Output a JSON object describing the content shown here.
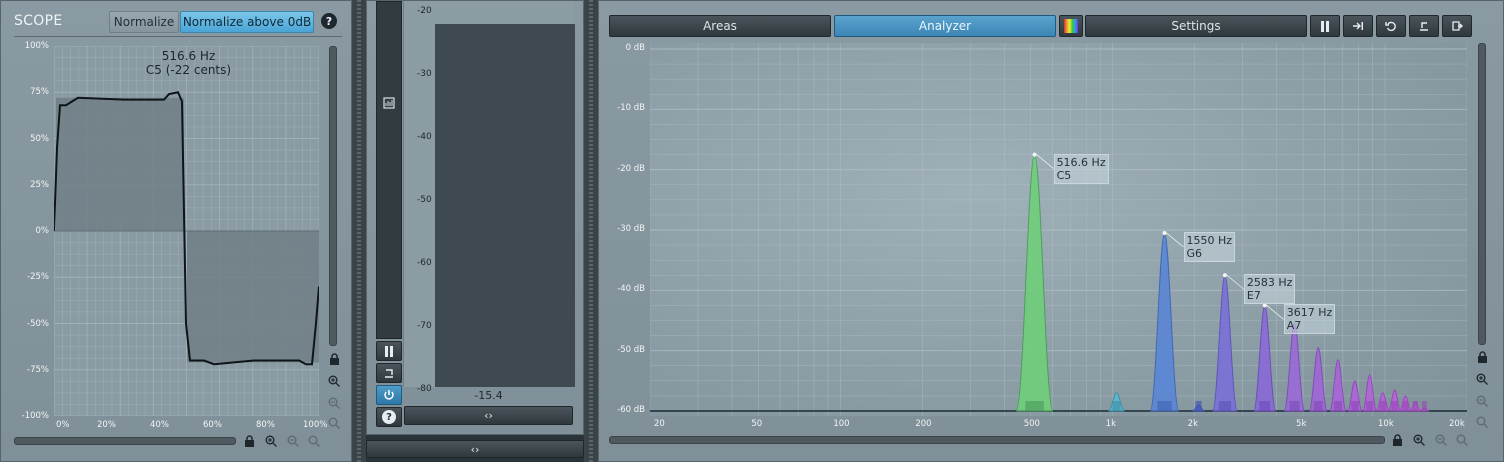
{
  "scope": {
    "title": "SCOPE",
    "normalize_label": "Normalize",
    "normalize_above_label": "Normalize above 0dB",
    "help_label": "?",
    "readout_freq": "516.6 Hz",
    "readout_note": "C5 (-22 cents)",
    "y_ticks": [
      "100%",
      "75%",
      "50%",
      "25%",
      "0%",
      "-25%",
      "-50%",
      "-75%",
      "-100%"
    ],
    "x_ticks": [
      "0%",
      "20%",
      "40%",
      "60%",
      "80%",
      "100%"
    ]
  },
  "meter": {
    "scale": [
      "-20",
      "-30",
      "-40",
      "-50",
      "-60",
      "-70",
      "-80"
    ],
    "value": "-15.4",
    "expand_label": "‹›",
    "bottom_expand_label": "‹›",
    "level_fraction": 0.94
  },
  "analyzer": {
    "tabs": [
      "Areas",
      "Analyzer",
      "Settings"
    ],
    "active_tab": "Analyzer",
    "y_ticks": [
      "0 dB",
      "-10 dB",
      "-20 dB",
      "-30 dB",
      "-40 dB",
      "-50 dB",
      "-60 dB"
    ],
    "x_ticks": [
      "20",
      "50",
      "100",
      "200",
      "500",
      "1k",
      "2k",
      "5k",
      "10k",
      "20k"
    ],
    "peaks": [
      {
        "freq": "516.6 Hz",
        "note": "C5"
      },
      {
        "freq": "1550 Hz",
        "note": "G6"
      },
      {
        "freq": "2583 Hz",
        "note": "E7"
      },
      {
        "freq": "3617 Hz",
        "note": "A7"
      }
    ]
  },
  "colors": {
    "accent": "#4aa5d6",
    "panel": "#8596a0",
    "plot": "#8c9da5"
  }
}
